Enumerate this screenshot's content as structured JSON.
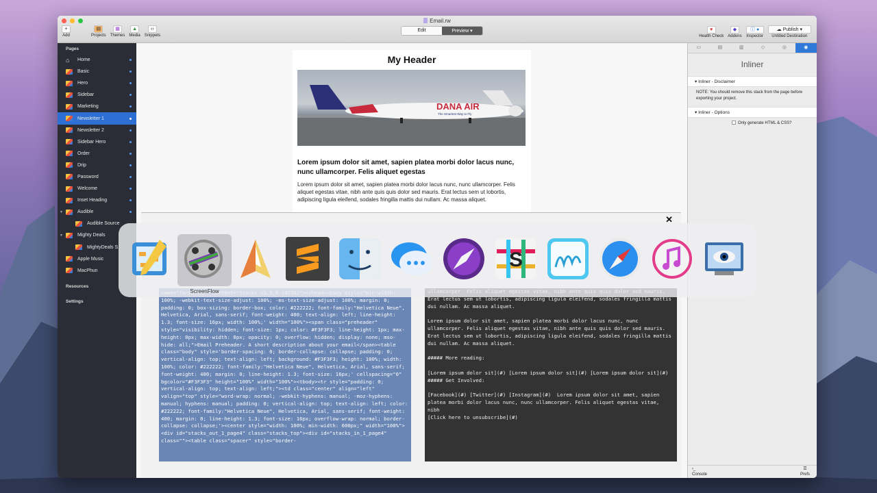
{
  "document": {
    "title": "Email.rw"
  },
  "toolbar": {
    "left": [
      {
        "label": "Add",
        "icon": "plus-icon"
      },
      {
        "label": "Projects",
        "icon": "projects-icon"
      },
      {
        "label": "Themes",
        "icon": "themes-icon"
      },
      {
        "label": "Media",
        "icon": "media-icon"
      },
      {
        "label": "Snippets",
        "icon": "snippets-icon"
      }
    ],
    "mode_edit": "Edit",
    "mode_preview": "Preview ▾",
    "right": [
      {
        "label": "Health Check",
        "icon": "heart-icon"
      },
      {
        "label": "Addons",
        "icon": "addons-icon"
      },
      {
        "label": "Inspector",
        "icon": "info-icon"
      }
    ],
    "publish_button": "Publish",
    "destination": "Untitled Destination"
  },
  "sidebar": {
    "pages_header": "Pages",
    "items": [
      {
        "label": "Home"
      },
      {
        "label": "Basic"
      },
      {
        "label": "Hero"
      },
      {
        "label": "Sidebar"
      },
      {
        "label": "Marketing"
      },
      {
        "label": "Newsletter 1"
      },
      {
        "label": "Newsletter 2"
      },
      {
        "label": "Sidebar Hero"
      },
      {
        "label": "Order"
      },
      {
        "label": "Drip"
      },
      {
        "label": "Password"
      },
      {
        "label": "Welcome"
      },
      {
        "label": "Inset Heading"
      },
      {
        "label": "Audible"
      },
      {
        "label": "Audible Source"
      },
      {
        "label": "Mighty Deals"
      },
      {
        "label": "MightyDeals S"
      },
      {
        "label": "Apple Music"
      },
      {
        "label": "MacPhun"
      }
    ],
    "resources_header": "Resources",
    "settings_header": "Settings"
  },
  "email_preview": {
    "header": "My Header",
    "image_text": "DANA AIR",
    "image_tagline": "The Smartest Way to Fly",
    "subheading": "Lorem ipsum dolor sit amet, sapien platea morbi dolor lacus nunc, nunc ullamcorper. Felis aliquet egestas",
    "body": "Lorem ipsum dolor sit amet, sapien platea morbi dolor lacus nunc, nunc ullamcorper. Felis aliquet egestas vitae, nibh ante quis quis dolor sed mauris. Erat lectus sem ut lobortis, adipiscing ligula eleifend, sodales fringilla mattis dui nullam. Ac massa aliquet."
  },
  "code_panel": {
    "close": "✕",
    "html_source": "name=\"formatter\" content=\"Stacks v3.5.8 (4138)\"></head><body style=\"min-width: 100%; -webkit-text-size-adjust: 100%; -ms-text-size-adjust: 100%; margin: 0; padding: 0; box-sizing: border-box; color: #222222; font-family:\"Helvetica Neue\", Helvetica, Arial, sans-serif; font-weight: 400; text-align: left; line-height: 1.3; font-size: 16px; width: 100%;' width=\"100%\"><span class=\"preheader\" style=\"visibility: hidden; font-size: 1px; color: #F3F3F3; line-height: 1px; max-height: 0px; max-width: 0px; opacity: 0; overflow: hidden; display: none; mso-hide: all;\">Email Preheader. A short description about your email</span><table class=\"body\" style='border-spacing: 0; border-collapse: collapse; padding: 0; vertical-align: top; text-align: left; background: #F3F3F3; height: 100%; width: 100%; color: #222222; font-family:\"Helvetica Neue\", Helvetica, Arial, sans-serif; font-weight: 400; margin: 0; line-height: 1.3; font-size: 16px;' cellspacing=\"0\" bgcolor=\"#F3F3F3\" height=\"100%\" width=\"100%\"><tbody><tr style=\"padding: 0; vertical-align: top; text-align: left;\"><td class=\"center\" align=\"left\" valign=\"top\" style=\"word-wrap: normal; -webkit-hyphens: manual; -moz-hyphens: manual; hyphens: manual; padding: 0; vertical-align: top; text-align: left; color: #222222; font-family:\"Helvetica Neue\", Helvetica, Arial, sans-serif; font-weight: 400; margin: 0; line-height: 1.3; font-size: 16px; overflow-wrap: normal; border-collapse: collapse;'><center style=\"width: 100%; min-width: 600px;\" width=\"100%\"><div id=\"stacks_out_1_page4\" class=\"stacks_top\"><div id=\"stacks_in_1_page4\" class=\"\"><table class=\"spacer\" style=\"border-",
    "markdown_source": "ullamcorper. Felis aliquet egestas vitae, nibh ante quis quis dolor sed mauris. Erat lectus sem ut lobortis, adipiscing ligula eleifend, sodales fringilla mattis dui nullam. Ac massa aliquet.\n\nLorem ipsum dolor sit amet, sapien platea morbi dolor lacus nunc, nunc ullamcorper. Felis aliquet egestas vitae, nibh ante quis quis dolor sed mauris. Erat lectus sem ut lobortis, adipiscing ligula eleifend, sodales fringilla mattis dui nullam. Ac massa aliquet.\n\n##### More reading:\n\n[Lorem ipsum dolor sit](#) [Lorem ipsum dolor sit](#) [Lorem ipsum dolor sit](#) ##### Get Involved:\n\n[Facebook](#) [Twitter](#) [Instagram](#)  Lorem ipsum dolor sit amet, sapien platea morbi dolor lacus nunc, nunc ullamcorper. Felis aliquet egestas vitae, nibh\n[Click here to unsubscribe](#)"
  },
  "inspector": {
    "title": "Inliner",
    "disclaimer_header": "Inliner - Disclaimer",
    "disclaimer_text": "NOTE: You should remove this stack from the page before exporting your project.",
    "options_header": "Inliner - Options",
    "option_label": "Only generate HTML & CSS?",
    "footer_left": "Console",
    "footer_right": "Prefs"
  },
  "app_switcher": {
    "selected_label": "ScreenFlow",
    "apps": [
      "Script Editor",
      "ScreenFlow",
      "Ulysses",
      "Sublime Text",
      "Finder",
      "Messages",
      "Compass",
      "Slack",
      "Notability",
      "Safari",
      "iTunes",
      "Preview"
    ]
  }
}
